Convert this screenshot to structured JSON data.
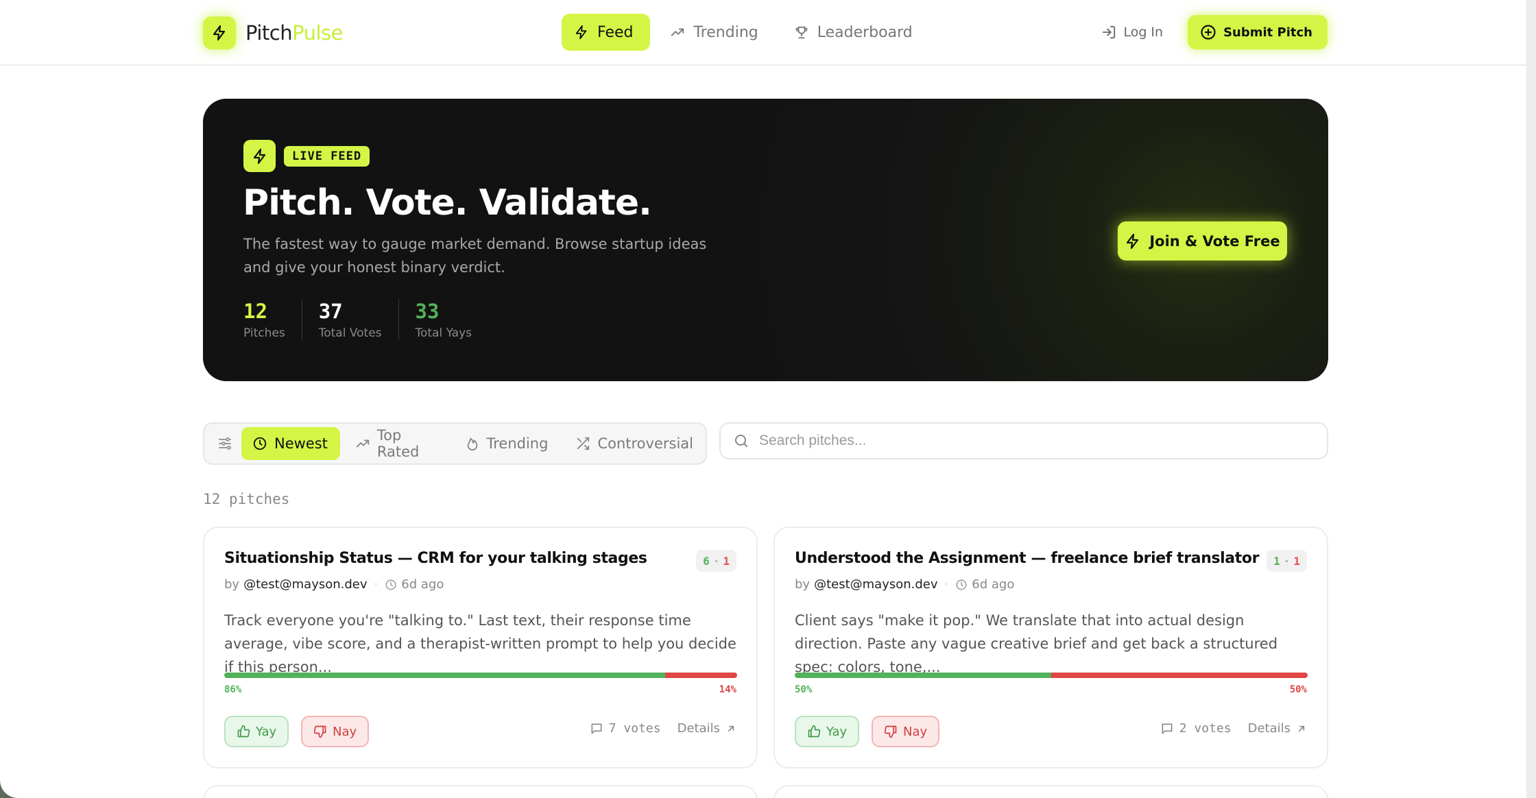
{
  "brand": {
    "name_part1": "Pitch",
    "name_part2": "Pulse",
    "accent_color": "#d4f545"
  },
  "nav": [
    {
      "label": "Feed",
      "icon": "bolt-icon",
      "active": true
    },
    {
      "label": "Trending",
      "icon": "trending-icon",
      "active": false
    },
    {
      "label": "Leaderboard",
      "icon": "trophy-icon",
      "active": false
    }
  ],
  "header": {
    "login_label": "Log In",
    "submit_label": "Submit Pitch"
  },
  "hero": {
    "badge": "LIVE FEED",
    "title": "Pitch. Vote. Validate.",
    "subtitle": "The fastest way to gauge market demand. Browse startup ideas and give your honest binary verdict.",
    "cta_label": "Join & Vote Free",
    "stats": [
      {
        "value": "12",
        "label": "Pitches",
        "color": "#d4f545"
      },
      {
        "value": "37",
        "label": "Total Votes",
        "color": "#ffffff"
      },
      {
        "value": "33",
        "label": "Total Yays",
        "color": "#52b25a"
      }
    ]
  },
  "filters": [
    {
      "label": "Newest",
      "icon": "clock-icon",
      "active": true
    },
    {
      "label": "Top Rated",
      "icon": "trending-icon",
      "active": false
    },
    {
      "label": "Trending",
      "icon": "flame-icon",
      "active": false
    },
    {
      "label": "Controversial",
      "icon": "shuffle-icon",
      "active": false
    }
  ],
  "search": {
    "placeholder": "Search pitches..."
  },
  "pitch_count_label": "12 pitches",
  "pitches": [
    {
      "title": "Situationship Status — CRM for your talking stages",
      "yays": "6",
      "nays": "1",
      "by": "by",
      "author": "@test@mayson.dev",
      "time": "6d ago",
      "description": "Track everyone you're \"talking to.\" Last text, their response time average, vibe score, and a therapist-written prompt to help you decide if this person...",
      "yay_pct": 86,
      "yay_pct_label": "86%",
      "nay_pct_label": "14%",
      "yay_label": "Yay",
      "nay_label": "Nay",
      "votes_label": "7 votes",
      "details_label": "Details"
    },
    {
      "title": "Understood the Assignment — freelance brief translator",
      "yays": "1",
      "nays": "1",
      "by": "by",
      "author": "@test@mayson.dev",
      "time": "6d ago",
      "description": "Client says \"make it pop.\" We translate that into actual design direction. Paste any vague creative brief and get back a structured spec: colors, tone,...",
      "yay_pct": 50,
      "yay_pct_label": "50%",
      "nay_pct_label": "50%",
      "yay_label": "Yay",
      "nay_label": "Nay",
      "votes_label": "2 votes",
      "details_label": "Details"
    }
  ]
}
